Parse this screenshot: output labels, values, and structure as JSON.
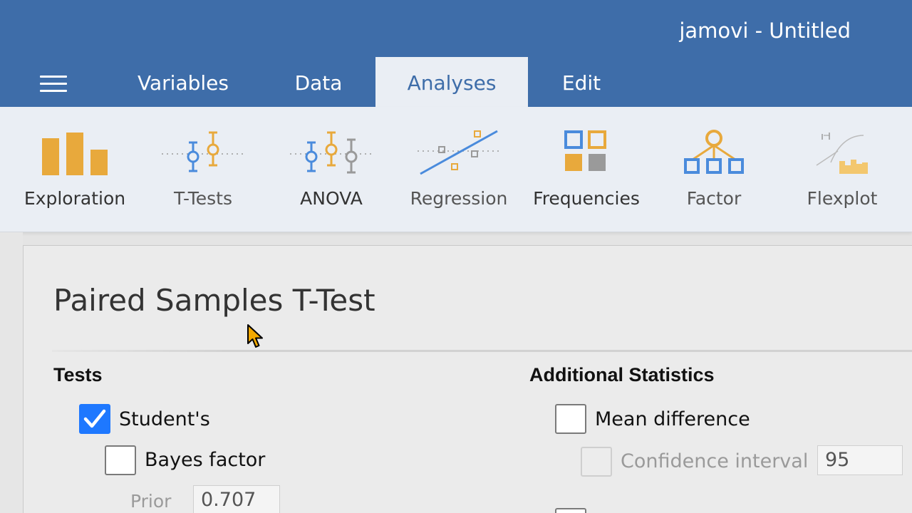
{
  "window": {
    "title": "jamovi - Untitled"
  },
  "tabs": [
    {
      "label": "Variables"
    },
    {
      "label": "Data"
    },
    {
      "label": "Analyses",
      "active": true
    },
    {
      "label": "Edit"
    }
  ],
  "ribbon": {
    "items": [
      {
        "label": "Exploration",
        "icon": "bar-chart-icon"
      },
      {
        "label": "T-Tests",
        "icon": "t-test-icon"
      },
      {
        "label": "ANOVA",
        "icon": "anova-icon"
      },
      {
        "label": "Regression",
        "icon": "regression-icon"
      },
      {
        "label": "Frequencies",
        "icon": "frequencies-icon"
      },
      {
        "label": "Factor",
        "icon": "factor-icon"
      },
      {
        "label": "Flexplot",
        "icon": "flexplot-icon"
      }
    ]
  },
  "panel": {
    "title": "Paired Samples T-Test",
    "tests": {
      "heading": "Tests",
      "students": {
        "label": "Student's",
        "checked": true
      },
      "bayes": {
        "label": "Bayes factor",
        "checked": false
      },
      "prior": {
        "label": "Prior",
        "value": "0.707"
      }
    },
    "additional": {
      "heading": "Additional Statistics",
      "mean_difference": {
        "label": "Mean difference",
        "checked": false
      },
      "confidence_interval": {
        "label": "Confidence interval",
        "value": "95"
      }
    }
  },
  "colors": {
    "header": "#3e6da9",
    "ribbon_bg": "#eaeef4",
    "icon_orange": "#e8a93c",
    "icon_blue": "#4a8bdc",
    "icon_gray": "#9a9a9a",
    "checkbox_blue": "#1e78ff"
  }
}
